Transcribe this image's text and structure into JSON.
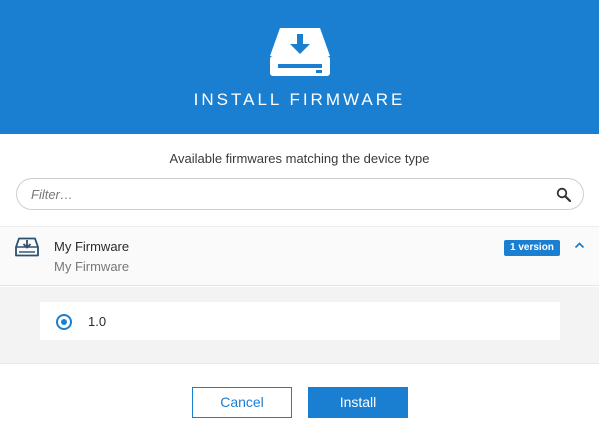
{
  "header": {
    "icon": "install-drive-icon",
    "title": "INSTALL FIRMWARE"
  },
  "subtitle": "Available firmwares matching the device type",
  "filter": {
    "placeholder": "Filter…",
    "value": "",
    "icon": "search-icon"
  },
  "firmware": {
    "icon": "install-drive-icon",
    "name": "My Firmware",
    "subtitle": "My Firmware",
    "badge": "1 version",
    "expanded": true,
    "versions": [
      {
        "label": "1.0",
        "selected": true
      }
    ]
  },
  "footer": {
    "cancel_label": "Cancel",
    "install_label": "Install"
  },
  "colors": {
    "accent": "#1a7fd1",
    "header_bg": "#1a7fd1"
  }
}
